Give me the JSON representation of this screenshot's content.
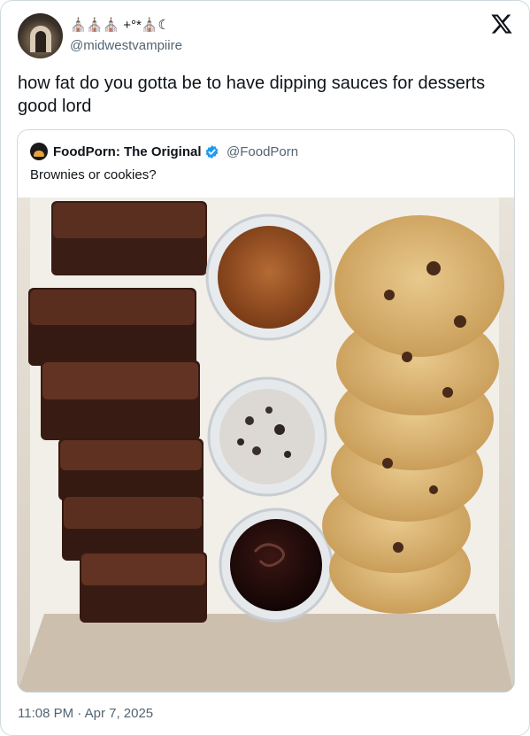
{
  "author": {
    "display_name": "⛪⛪⛪ +°*⛪☾",
    "handle": "@midwestvampiire"
  },
  "tweet": {
    "text": "how fat do you gotta be to have dipping sauces for desserts good lord"
  },
  "quoted": {
    "name": "FoodPorn: The Original",
    "handle": "@FoodPorn",
    "text": "Brownies or cookies?"
  },
  "meta": {
    "timestamp": "11:08 PM · Apr 7, 2025"
  },
  "colors": {
    "text_primary": "#0f1419",
    "text_secondary": "#536471",
    "border": "#cfd9de",
    "verified": "#1d9bf0"
  },
  "icons": {
    "platform": "x-logo-icon",
    "verified": "verified-badge-icon"
  }
}
